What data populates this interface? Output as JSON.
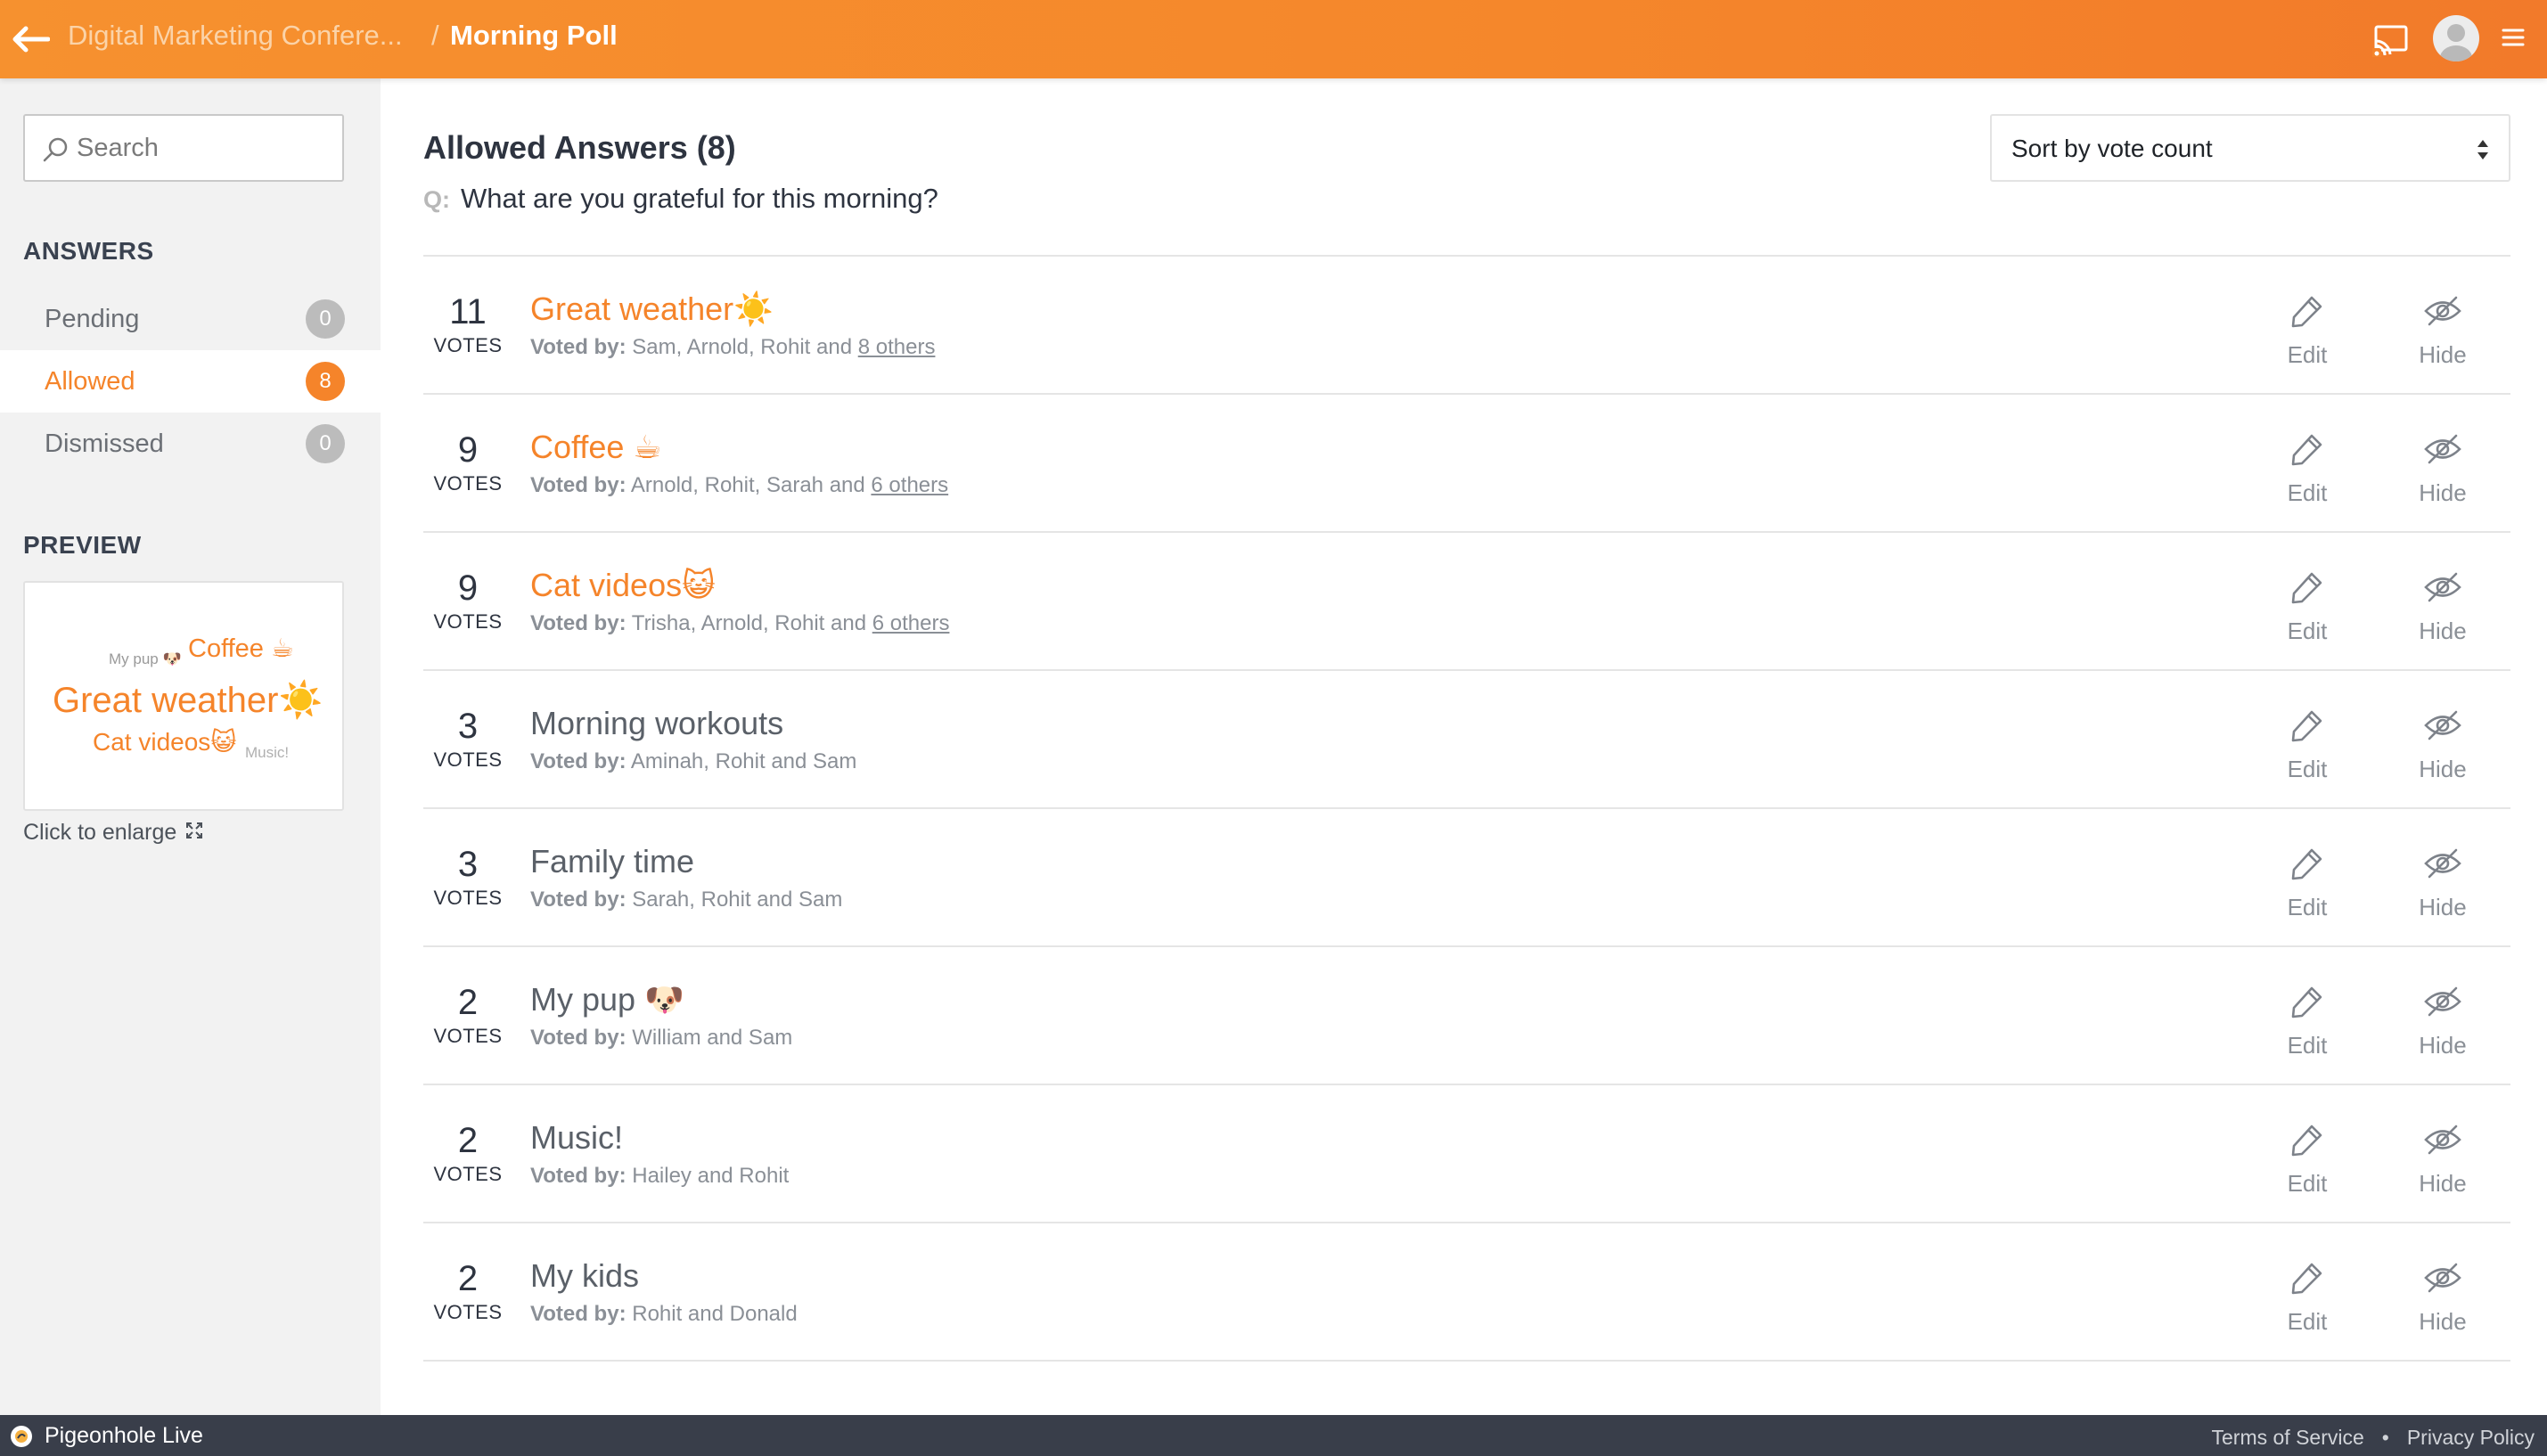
{
  "header": {
    "event_name": "Digital Marketing Confere...",
    "separator": "/",
    "current_page": "Morning Poll",
    "icons": [
      "back-arrow-icon",
      "cast-icon",
      "avatar-icon",
      "menu-icon"
    ]
  },
  "sidebar": {
    "search_placeholder": "Search",
    "answers_title": "ANSWERS",
    "items": [
      {
        "label": "Pending",
        "count": "0",
        "active": false
      },
      {
        "label": "Allowed",
        "count": "8",
        "active": true
      },
      {
        "label": "Dismissed",
        "count": "0",
        "active": false
      }
    ],
    "preview_title": "PREVIEW",
    "preview_words": [
      "My pup 🐶",
      "Coffee ☕",
      "Great weather☀️",
      "Cat videos😺",
      "Music!"
    ],
    "enlarge_label": "Click to enlarge"
  },
  "main": {
    "title": "Allowed Answers (8)",
    "question_prefix": "Q:",
    "question": "What are you grateful for this morning?",
    "sort_label": "Sort by vote count",
    "votes_label": "VOTES",
    "voted_by_label": "Voted by:",
    "edit_label": "Edit",
    "hide_label": "Hide",
    "answers": [
      {
        "votes": "11",
        "text": "Great weather☀️",
        "highlight": true,
        "voters": "Sam, Arnold, Rohit and",
        "others": "8 others"
      },
      {
        "votes": "9",
        "text": "Coffee ☕",
        "highlight": true,
        "voters": "Arnold, Rohit, Sarah and",
        "others": "6 others"
      },
      {
        "votes": "9",
        "text": "Cat videos😺",
        "highlight": true,
        "voters": "Trisha, Arnold, Rohit and",
        "others": "6 others"
      },
      {
        "votes": "3",
        "text": "Morning workouts",
        "highlight": false,
        "voters": "Aminah, Rohit and Sam",
        "others": ""
      },
      {
        "votes": "3",
        "text": "Family time",
        "highlight": false,
        "voters": "Sarah, Rohit and Sam",
        "others": ""
      },
      {
        "votes": "2",
        "text": "My pup 🐶",
        "highlight": false,
        "voters": "William and Sam",
        "others": ""
      },
      {
        "votes": "2",
        "text": "Music!",
        "highlight": false,
        "voters": "Hailey and Rohit",
        "others": ""
      },
      {
        "votes": "2",
        "text": "My kids",
        "highlight": false,
        "voters": "Rohit and Donald",
        "others": ""
      }
    ]
  },
  "footer": {
    "brand": "Pigeonhole Live",
    "links": [
      "Terms of Service",
      "Privacy Policy"
    ],
    "link_separator": "•"
  },
  "colors": {
    "brand_orange": "#f5842a",
    "footer_bg": "#393e4a",
    "sidebar_bg": "#f2f2f2"
  }
}
